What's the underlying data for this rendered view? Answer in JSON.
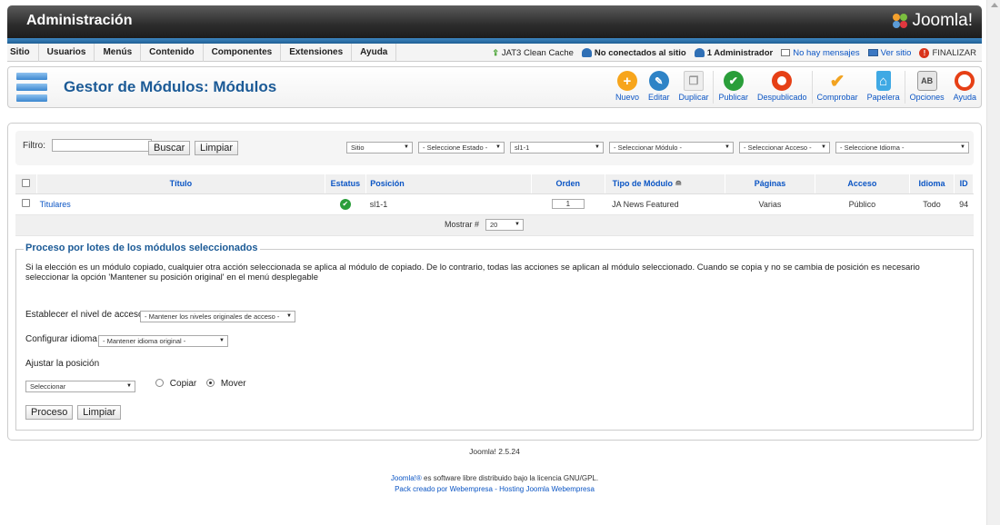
{
  "header": {
    "title": "Administración",
    "logo_text": "Joomla!"
  },
  "menu": [
    "Sitio",
    "Usuarios",
    "Menús",
    "Contenido",
    "Componentes",
    "Extensiones",
    "Ayuda"
  ],
  "status": {
    "cache": "JAT3 Clean Cache",
    "visitors": "No conectados al sitio",
    "admins": "1 Administrador",
    "messages": "No hay mensajes",
    "view_site": "Ver sitio",
    "logout": "FINALIZAR"
  },
  "page_title": "Gestor de Módulos: Módulos",
  "toolbar": [
    {
      "label": "Nuevo",
      "icon": "plus-icon",
      "color": "#f7a51c"
    },
    {
      "label": "Editar",
      "icon": "pencil-icon",
      "color": "#2e83c6"
    },
    {
      "label": "Duplicar",
      "icon": "copy-icon",
      "color": "#cfcfcf"
    },
    {
      "label": "Publicar",
      "icon": "check-icon",
      "color": "#2a9e3a"
    },
    {
      "label": "Despublicado",
      "icon": "stop-icon",
      "color": "#e64016"
    },
    {
      "label": "Comprobar",
      "icon": "checkin-icon",
      "color": "#f2a321"
    },
    {
      "label": "Papelera",
      "icon": "trash-icon",
      "color": "#3fa9e4"
    },
    {
      "label": "Opciones",
      "icon": "options-icon",
      "color": "#bbbbbb"
    },
    {
      "label": "Ayuda",
      "icon": "help-icon",
      "color": "#e64016"
    }
  ],
  "filter": {
    "label": "Filtro:",
    "search_btn": "Buscar",
    "clear_btn": "Limpiar",
    "selects": [
      "Sitio",
      "- Seleccione Estado -",
      "sl1-1",
      "- Seleccionar Módulo -",
      "- Seleccionar Acceso -",
      "- Seleccione Idioma -"
    ]
  },
  "table": {
    "headers": [
      "Título",
      "Estatus",
      "Posición",
      "Orden",
      "Tipo de Módulo",
      "Páginas",
      "Acceso",
      "Idioma",
      "ID"
    ],
    "rows": [
      {
        "title": "Titulares",
        "position": "sl1-1",
        "order": "1",
        "type": "JA News Featured",
        "pages": "Varias",
        "access": "Público",
        "language": "Todo",
        "id": "94"
      }
    ],
    "pager_label": "Mostrar #",
    "pager_value": "20"
  },
  "batch": {
    "legend": "Proceso por lotes de los módulos seleccionados",
    "description": "Si la elección es un módulo copiado, cualquier otra acción seleccionada se aplica al módulo de copiado. De lo contrario, todas las acciones se aplican al módulo seleccionado. Cuando se copia y no se cambia de posición es necesario seleccionar la opción 'Mantener su posición original' en el menú desplegable",
    "access_label": "Establecer el nivel de acceso",
    "access_value": "- Mantener los niveles originales de acceso -",
    "language_label": "Configurar idioma",
    "language_value": "- Mantener idioma original -",
    "position_label": "Ajustar la posición",
    "position_value": "Seleccionar",
    "copy_label": "Copiar",
    "move_label": "Mover",
    "process_btn": "Proceso",
    "clear_btn": "Limpiar"
  },
  "footer": {
    "version": "Joomla! 2.5.24",
    "license_link": "Joomla!®",
    "license_text": " es software libre distribuido bajo la licencia GNU/GPL.",
    "pack": "Pack creado por Webempresa - Hosting Joomla Webempresa"
  }
}
